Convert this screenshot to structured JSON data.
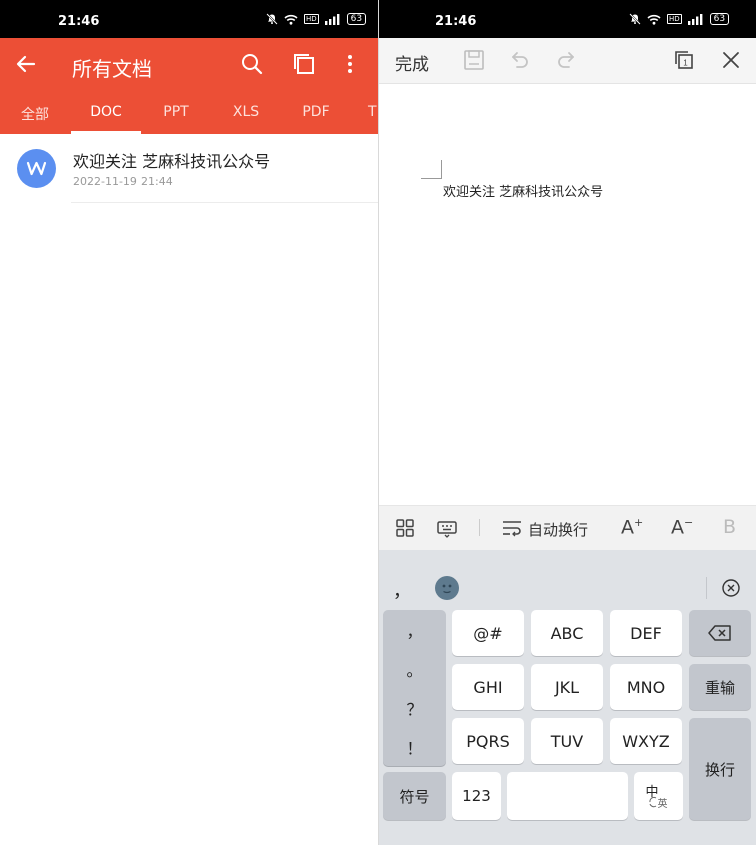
{
  "left": {
    "status": {
      "time": "21:46",
      "battery": "63",
      "hd": "HD"
    },
    "title": "所有文档",
    "tabs": [
      {
        "label": "全部"
      },
      {
        "label": "DOC"
      },
      {
        "label": "PPT"
      },
      {
        "label": "XLS"
      },
      {
        "label": "PDF"
      },
      {
        "label": "T"
      }
    ],
    "active_tab": "DOC",
    "files": [
      {
        "name": "欢迎关注 芝麻科技讯公众号",
        "date": "2022-11-19",
        "time": "21:44"
      }
    ]
  },
  "right": {
    "status": {
      "time": "21:46",
      "battery": "63",
      "hd": "HD"
    },
    "toolbar": {
      "done_label": "完成"
    },
    "document": {
      "text": "欢迎关注  芝麻科技讯公众号"
    },
    "format_bar": {
      "wrap_label": "自动换行",
      "a_plus": "A",
      "a_minus": "A",
      "bold": "B"
    },
    "keyboard": {
      "candidate": "，",
      "punctuation": [
        "，",
        "。",
        "？",
        "！"
      ],
      "rows": [
        [
          "@#",
          "ABC",
          "DEF"
        ],
        [
          "GHI",
          "JKL",
          "MNO"
        ],
        [
          "PQRS",
          "TUV",
          "WXYZ"
        ]
      ],
      "reenter_label": "重输",
      "newline_label": "换行",
      "symbols_label": "符号",
      "num_label": "123",
      "lang_main": "中",
      "lang_sub": "英"
    }
  },
  "colors": {
    "accent": "#ec4f36",
    "file_icon": "#5b8ff0",
    "keyboard_bg": "#dfe2e6"
  }
}
